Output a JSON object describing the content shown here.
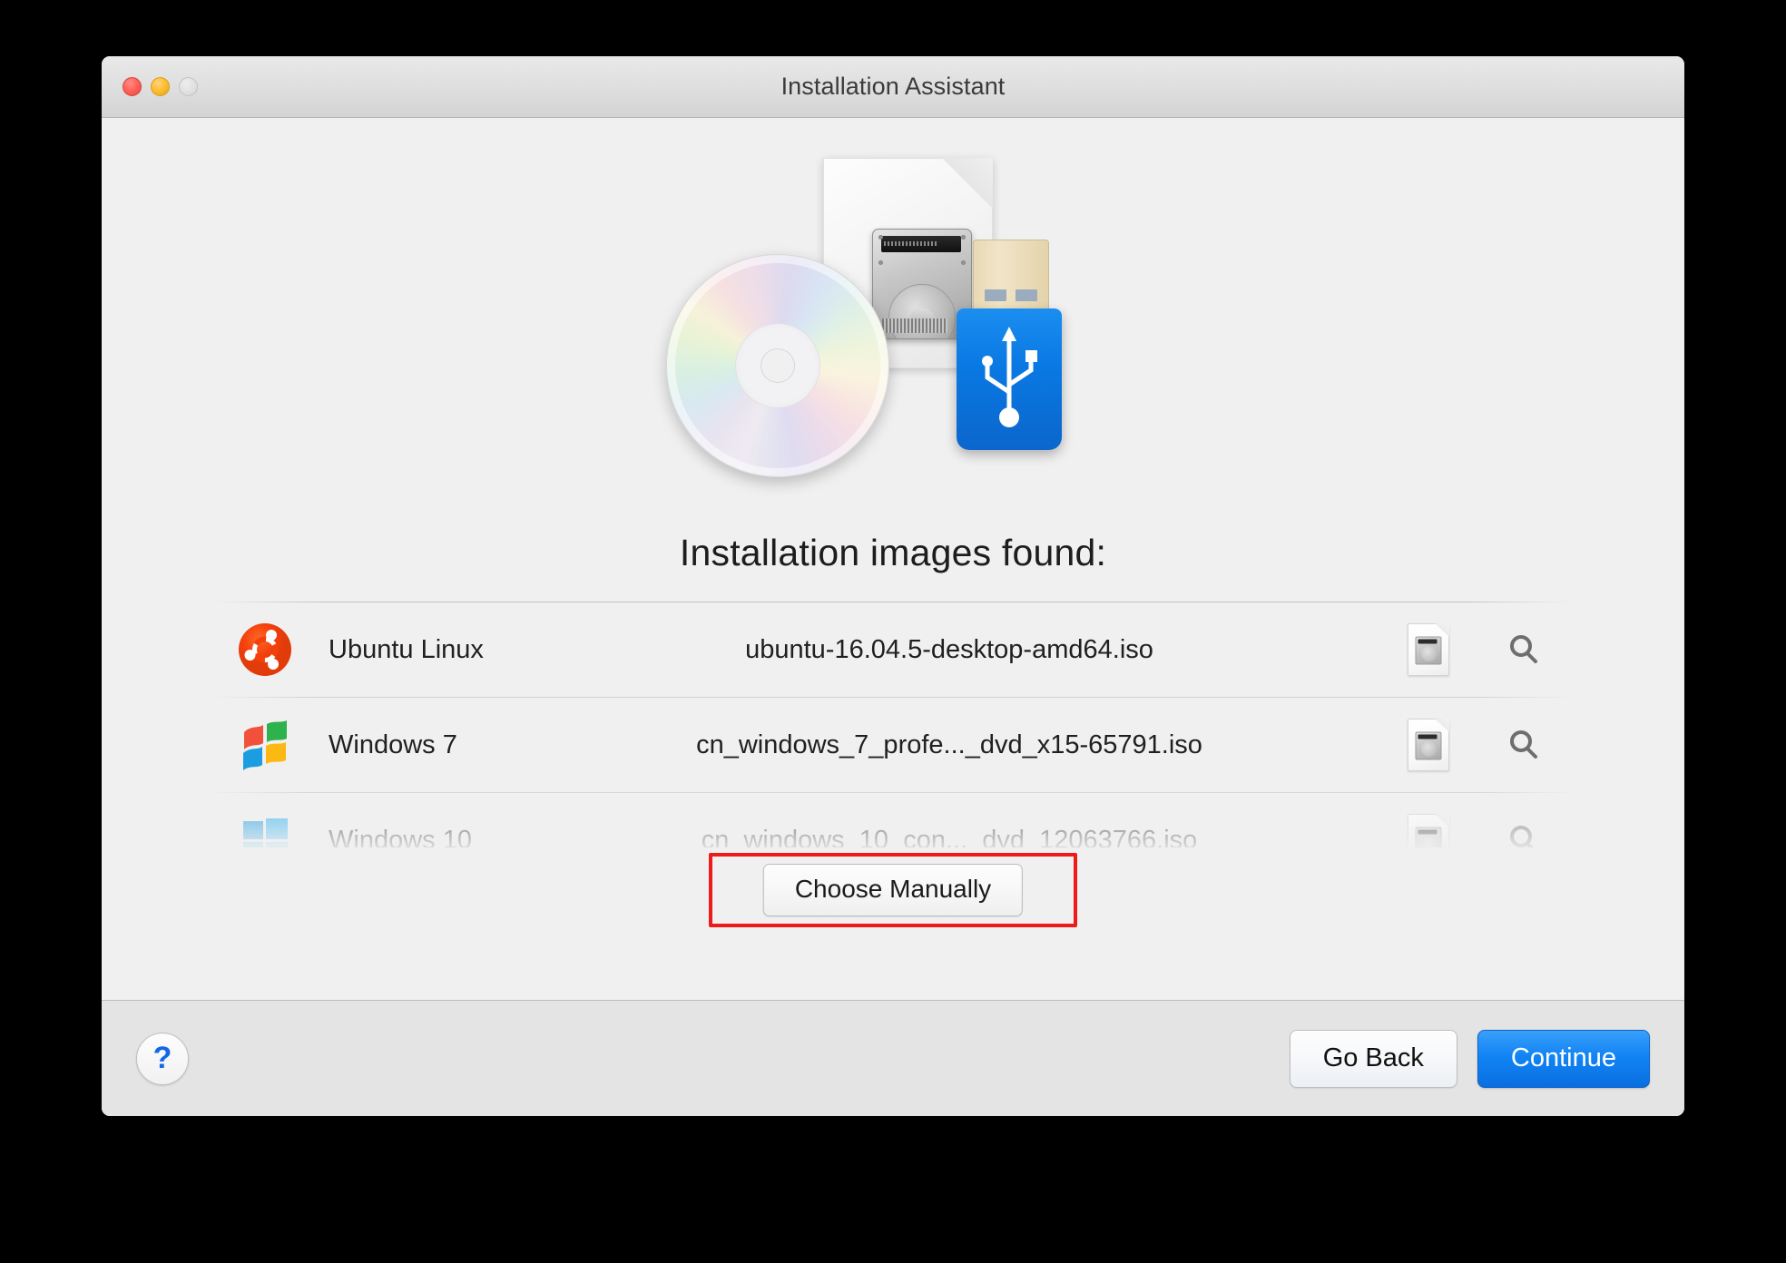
{
  "window": {
    "title": "Installation Assistant",
    "traffic_lights": [
      {
        "name": "close-button",
        "color": "#ff6159"
      },
      {
        "name": "minimize-button",
        "color": "#ffbd2e"
      },
      {
        "name": "zoom-button",
        "color": "#e2e2e2"
      }
    ]
  },
  "hero": {
    "icons": [
      "cd-disc-icon",
      "disk-image-document-icon",
      "usb-drive-icon"
    ]
  },
  "main": {
    "heading": "Installation images found:",
    "rows": [
      {
        "logo": "ubuntu-logo-icon",
        "os": "Ubuntu Linux",
        "file": "ubuntu-16.04.5-desktop-amd64.iso",
        "file_icon": "disk-image-file-icon",
        "reveal_icon": "magnifier-icon"
      },
      {
        "logo": "windows-7-logo-icon",
        "os": "Windows 7",
        "file": "cn_windows_7_profe..._dvd_x15-65791.iso",
        "file_icon": "disk-image-file-icon",
        "reveal_icon": "magnifier-icon"
      },
      {
        "logo": "windows-10-logo-icon",
        "os": "Windows 10",
        "file": "cn_windows_10_con..._dvd_12063766.iso",
        "file_icon": "disk-image-file-icon",
        "reveal_icon": "magnifier-icon"
      }
    ],
    "choose_manually_label": "Choose Manually",
    "highlight_color": "#ee1b1b"
  },
  "footer": {
    "help_label": "?",
    "go_back_label": "Go Back",
    "continue_label": "Continue",
    "continue_color": "#1184f4"
  }
}
